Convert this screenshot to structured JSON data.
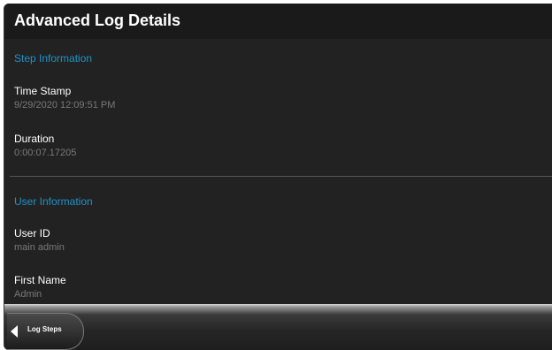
{
  "header": {
    "title": "Advanced Log Details"
  },
  "sections": {
    "step": {
      "heading": "Step Information",
      "time_stamp_label": "Time Stamp",
      "time_stamp_value": "9/29/2020 12:09:51 PM",
      "duration_label": "Duration",
      "duration_value": "0:00:07.17205"
    },
    "user": {
      "heading": "User Information",
      "user_id_label": "User ID",
      "user_id_value": "main admin",
      "first_name_label": "First Name",
      "first_name_value": "Admin"
    }
  },
  "footer": {
    "back_label": "Log Steps",
    "back_icon": "back-arrow-icon"
  },
  "colors": {
    "accent": "#1e93c8",
    "background": "#222222",
    "label": "#ffffff",
    "value": "#7a7a7a"
  }
}
